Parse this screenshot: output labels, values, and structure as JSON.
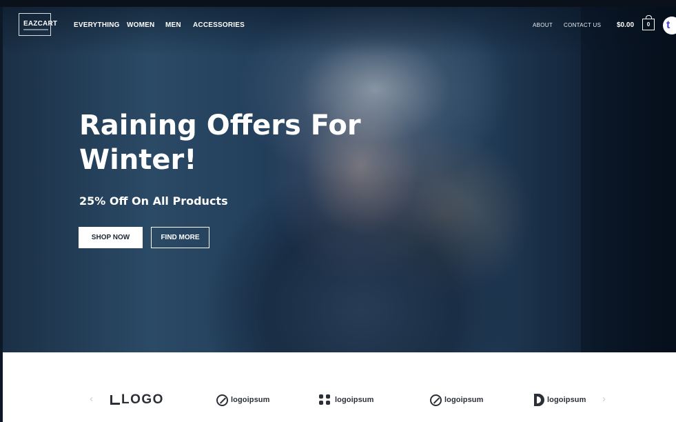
{
  "brand": {
    "name": "EAZCART"
  },
  "nav": {
    "main": [
      "EVERYTHING",
      "WOMEN",
      "MEN",
      "ACCESSORIES"
    ],
    "secondary": [
      "ABOUT",
      "CONTACT US"
    ]
  },
  "cart": {
    "total": "$0.00",
    "count": "0"
  },
  "extension_badge": "t",
  "hero": {
    "title": "Raining Offers For Winter!",
    "subtitle": "25% Off On All Products",
    "primary_button": "SHOP NOW",
    "secondary_button": "FIND MORE"
  },
  "logos": {
    "items": [
      "LOGO",
      "logoipsum",
      "logoipsum",
      "logoipsum",
      "logoipsum"
    ],
    "prev_icon": "chevron-left-icon",
    "next_icon": "chevron-right-icon"
  }
}
